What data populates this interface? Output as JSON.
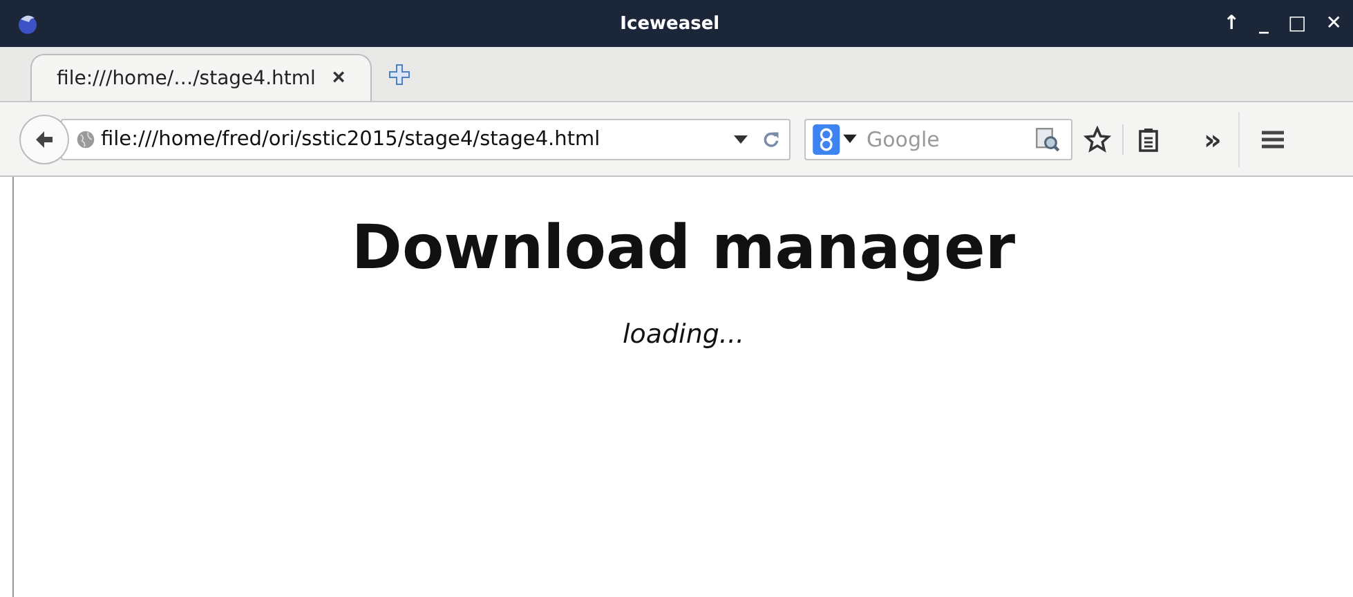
{
  "window": {
    "title": "Iceweasel",
    "controls": [
      "↑",
      "_",
      "□",
      "✕"
    ]
  },
  "tabs": [
    {
      "label": "file:///home/…/stage4.html",
      "selected": true,
      "close": "×"
    }
  ],
  "toolbar": {
    "url": "file:///home/fred/ori/sstic2015/stage4/stage4.html",
    "search": {
      "placeholder": "Google"
    },
    "overflow": "»"
  },
  "page": {
    "heading": "Download manager",
    "status": "loading..."
  }
}
